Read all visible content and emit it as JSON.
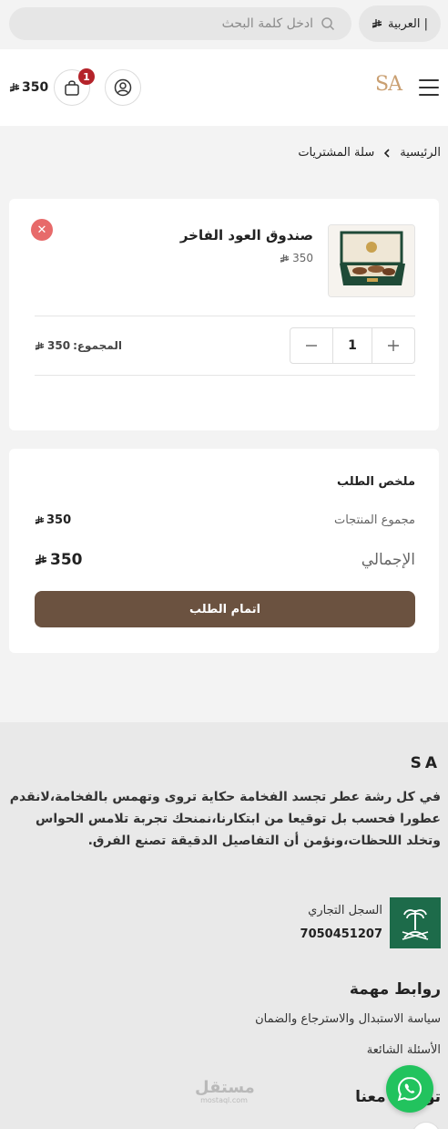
{
  "currency_symbol": "⃁",
  "top_bar": {
    "language_label": "العربية |",
    "search_placeholder": "ادخل كلمة البحث"
  },
  "header": {
    "logo": "SA",
    "cart_count": "1",
    "cart_total": "350"
  },
  "breadcrumb": {
    "home": "الرئيسية",
    "current": "سلة المشتريات"
  },
  "cart_item": {
    "name": "صندوق العود الفاخر",
    "price": "350",
    "quantity": "1",
    "line_total_label": "المجموع:",
    "line_total_value": "350"
  },
  "summary": {
    "title": "ملخص الطلب",
    "subtotal_label": "مجموع المنتجات",
    "subtotal_value": "350",
    "total_label": "الإجمالي",
    "total_value": "350",
    "checkout_label": "اتمام الطلب"
  },
  "footer": {
    "brand": "SA",
    "about": "في كل رشة عطر تجسد الفخامة حكاية تروى وتهمس بالفخامة،لانقدم عطورا فحسب بل توقيعا من ابتكارنا،نمنحك تجربة تلامس الحواس وتخلد اللحظات،ونؤمن أن التفاصيل الدقيقة تصنع الفرق.",
    "commercial_register_label": "السجل التجاري",
    "commercial_register_number": "7050451207",
    "links_title": "روابط مهمة",
    "links": [
      "سياسة الاستبدال والاسترجاع والضمان",
      "الأسئلة الشائعة"
    ],
    "contact_title": "تواصل معنا"
  },
  "watermark": {
    "name": "مستقل",
    "domain": "mostaql.com"
  },
  "colors": {
    "accent": "#6b5240",
    "logo": "#caa072",
    "badge": "#b4232a",
    "remove": "#e76a6a",
    "whatsapp": "#22c35e"
  }
}
